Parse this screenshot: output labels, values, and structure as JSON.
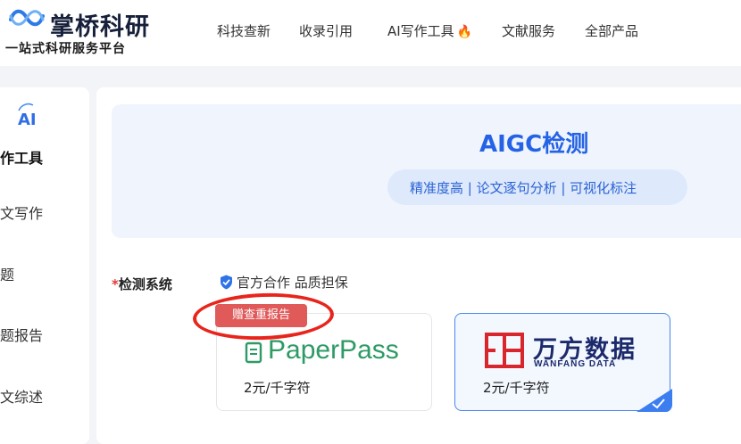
{
  "brand": {
    "name": "掌桥科研",
    "slogan": "一站式科研服务平台"
  },
  "nav": {
    "items": [
      "科技查新",
      "收录引用",
      "AI写作工具",
      "文献服务",
      "全部产品"
    ]
  },
  "sidebar": {
    "ai_label": "AI",
    "section_title": "作工具",
    "items": [
      "文写作",
      "题",
      "题报告",
      "文综述"
    ]
  },
  "hero": {
    "title": "AIGC检测",
    "subtitle": "精准度高 | 论文逐句分析 | 可视化标注"
  },
  "form": {
    "required_mark": "*",
    "label": "检测系统",
    "guarantee": "官方合作 品质担保"
  },
  "systems": [
    {
      "logo_text": "PaperPass",
      "price": "2元/千字符",
      "badge": "赠查重报告",
      "selected": false
    },
    {
      "logo_text": "万方数据",
      "logo_sub": "WANFANG DATA",
      "price": "2元/千字符",
      "selected": true
    }
  ],
  "colors": {
    "accent": "#2563e6",
    "badge": "#e05a5a",
    "annotation": "#e8251c",
    "paperpass": "#2e9a66",
    "wanfang_red": "#d9262c"
  }
}
